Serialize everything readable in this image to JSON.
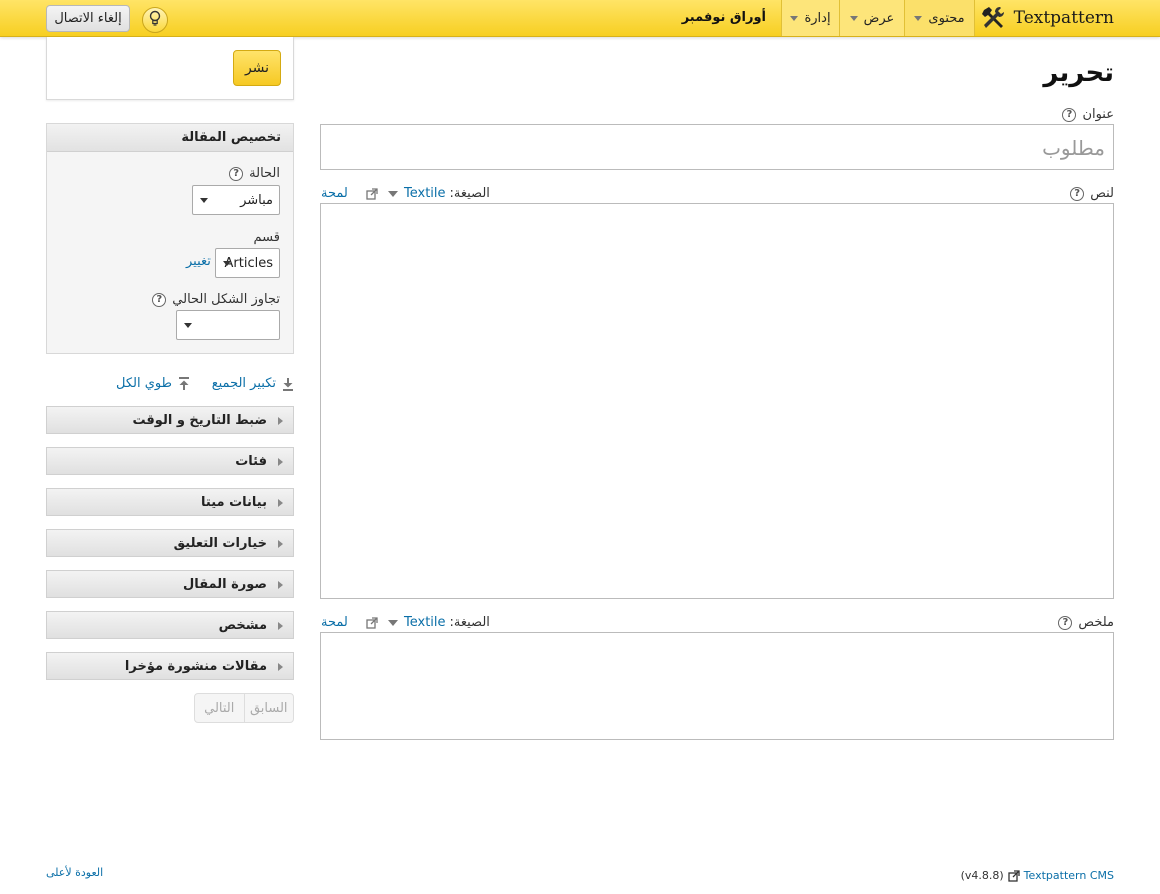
{
  "header": {
    "brand": "Textpattern",
    "nav": {
      "content": "محتوى",
      "view": "عرض",
      "admin": "إدارة"
    },
    "site_name": "أوراق نوفمبر",
    "logout": "إلغاء الاتصال"
  },
  "publish": {
    "label": "نشر"
  },
  "customize": {
    "title": "تخصيص المقالة",
    "status_label": "الحالة",
    "status_value": "مباشر",
    "section_label": "قسم",
    "section_value": "Articles",
    "change_link": "تغيير",
    "override_label": "تجاوز الشكل الحالي",
    "override_value": ""
  },
  "toggles": {
    "expand_all": "تكبير الجميع",
    "collapse_all": "طوي الكل"
  },
  "sections": [
    "ضبط التاريخ و الوقت",
    "فئات",
    "بيانات ميتا",
    "خيارات التعليق",
    "صورة المقال",
    "مشخص",
    "مقالات منشورة مؤخرا"
  ],
  "pager": {
    "prev": "السابق",
    "next": "التالي"
  },
  "main": {
    "page_title": "تحرير",
    "title_label": "عنوان",
    "title_placeholder": "مطلوب",
    "body_label": "لنص",
    "excerpt_label": "ملخص",
    "format_label": "الصيغة:",
    "format_value": "Textile",
    "preview_link": "لمحة"
  },
  "footer": {
    "back_to_top": "العودة لأعلى",
    "cms_link": "Textpattern CMS",
    "version": "(v4.8.8)"
  }
}
